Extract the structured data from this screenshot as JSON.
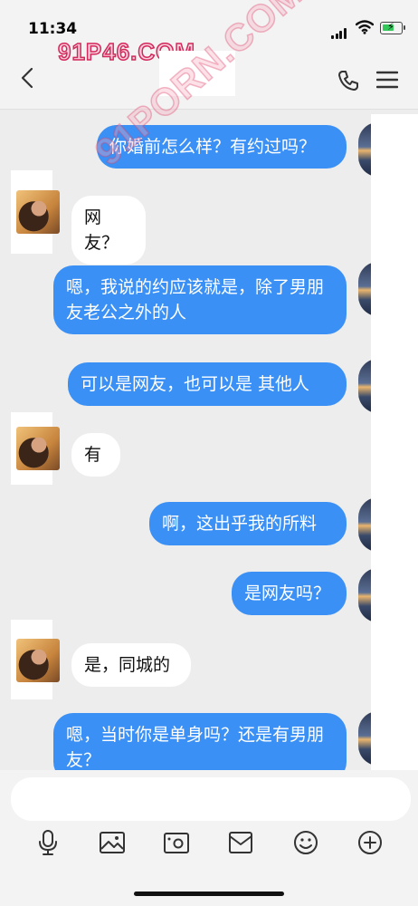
{
  "status": {
    "time": "11:34"
  },
  "header": {
    "watermark": "91P46.COM"
  },
  "overlay": {
    "diagonal_watermark": "91PORN.COM"
  },
  "messages": [
    {
      "side": "out",
      "text": "你婚前怎么样？有约过吗？"
    },
    {
      "side": "in",
      "text": "网友？"
    },
    {
      "side": "out",
      "text": "嗯，我说的约应该就是，除了男朋友老公之外的人"
    },
    {
      "side": "out",
      "text": "可以是网友，也可以是 其他人"
    },
    {
      "side": "in",
      "text": "有"
    },
    {
      "side": "out",
      "text": "啊，这出乎我的所料"
    },
    {
      "side": "out",
      "text": "是网友吗？"
    },
    {
      "side": "in",
      "text": "是，同城的"
    },
    {
      "side": "out",
      "text": "嗯，当时你是单身吗？还是有男朋友？"
    }
  ],
  "input": {
    "placeholder": ""
  },
  "toolbar": {
    "items": [
      "microphone-icon",
      "image-icon",
      "camera-icon",
      "envelope-icon",
      "emoji-icon",
      "plus-icon"
    ]
  },
  "colors": {
    "outgoing": "#3b90f5",
    "incoming": "#ffffff",
    "background": "#ededed"
  }
}
